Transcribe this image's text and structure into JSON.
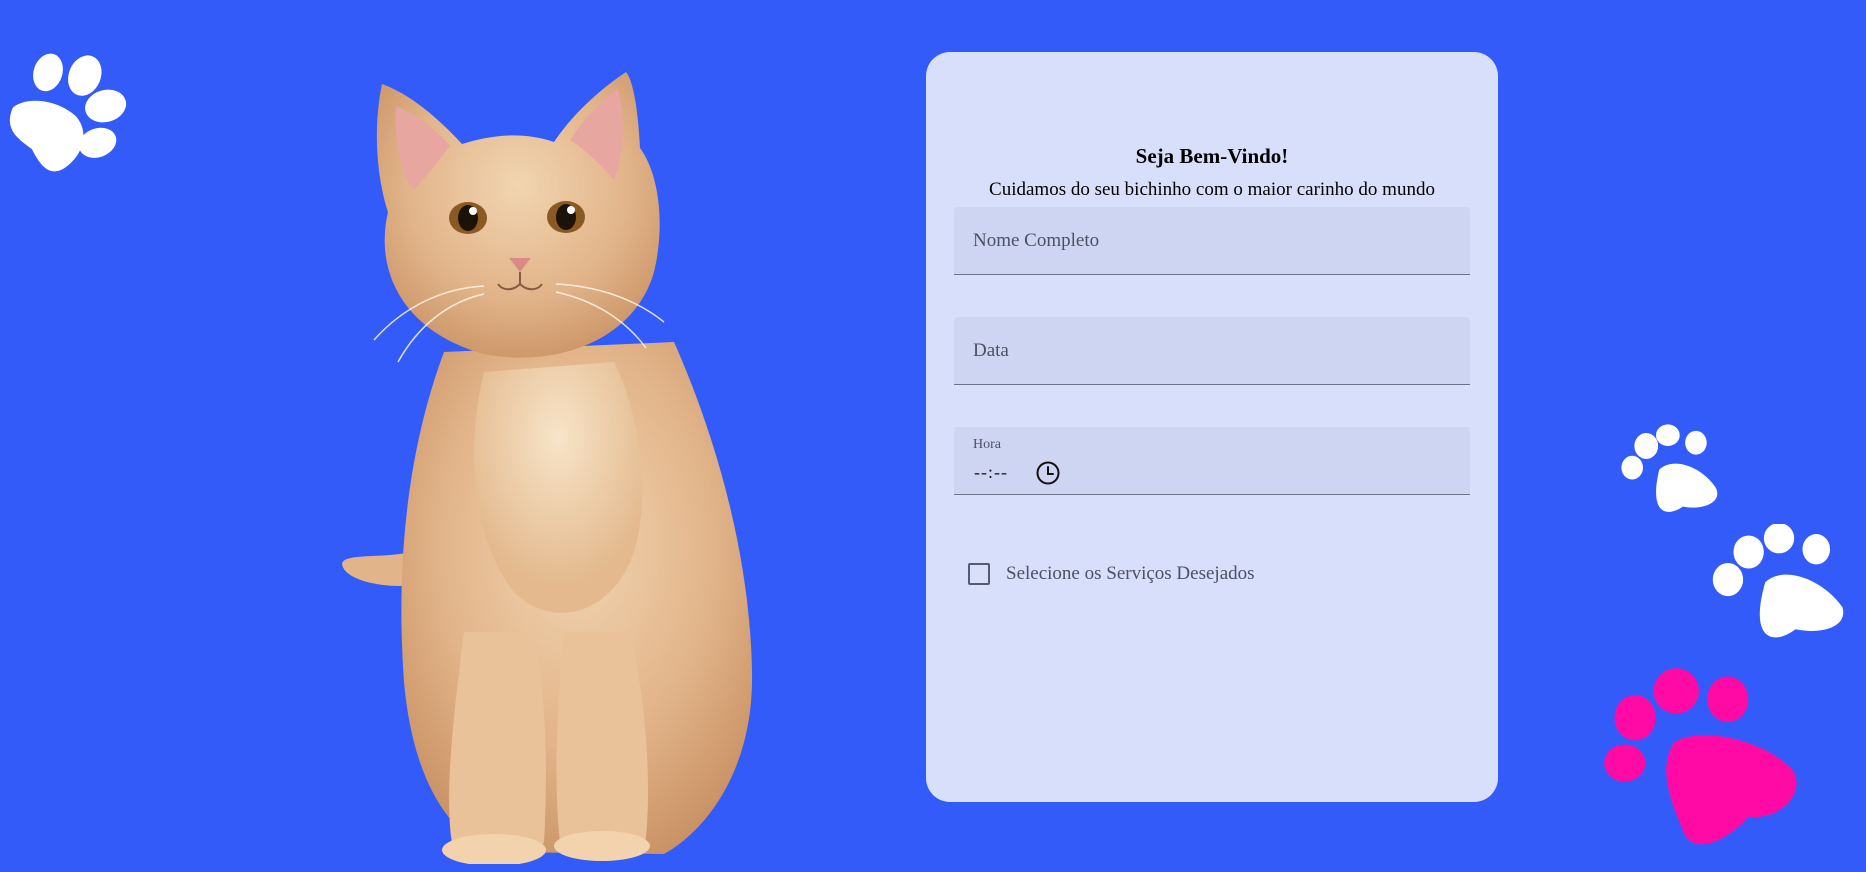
{
  "colors": {
    "background": "#325BF9",
    "card": "#D8DFFB",
    "field": "#CDD5F3",
    "paw_white": "#FFFFFF",
    "paw_pink": "#FF0AA5"
  },
  "decorations": {
    "paws": [
      "paw-icon",
      "paw-icon",
      "paw-icon",
      "paw-icon"
    ],
    "illustration": "cat-image"
  },
  "card": {
    "title": "Seja Bem-Vindo!",
    "subtitle": "Cuidamos do seu bichinho com o maior carinho do mundo"
  },
  "form": {
    "name_placeholder": "Nome Completo",
    "date_placeholder": "Data",
    "time_label": "Hora",
    "time_value": "--:--",
    "time_icon": "clock-icon",
    "services_label": "Selecione os Serviços Desejados",
    "services_checked": false
  }
}
